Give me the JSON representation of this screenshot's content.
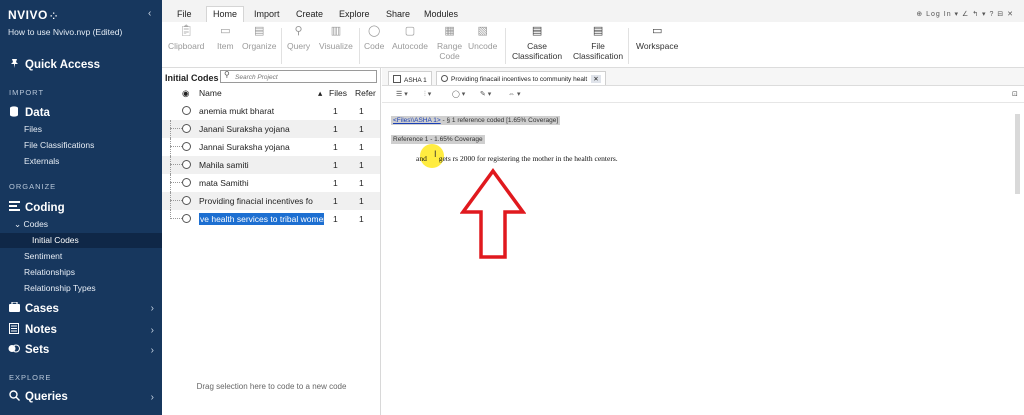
{
  "app": {
    "logo": "NVIVO",
    "logo_dots": "⁘",
    "project_name": "How to use Nvivo.nvp (Edited)"
  },
  "sidebar": {
    "collapse": "‹",
    "quick_access": "Quick Access",
    "section_import": "IMPORT",
    "data": "Data",
    "data_items": [
      "Files",
      "File Classifications",
      "Externals"
    ],
    "section_organize": "ORGANIZE",
    "coding": "Coding",
    "coding_codes": "Codes",
    "coding_initial_codes": "Initial Codes",
    "coding_items": [
      "Sentiment",
      "Relationships",
      "Relationship Types"
    ],
    "cases": "Cases",
    "notes": "Notes",
    "sets": "Sets",
    "section_explore": "EXPLORE",
    "queries": "Queries"
  },
  "ribbon": {
    "tabs": [
      "File",
      "Home",
      "Import",
      "Create",
      "Explore",
      "Share",
      "Modules"
    ],
    "active_tab": "Home",
    "top_right": "⊕ Log In ▾ ∠ ↰ ▾ ? ⊟ ✕",
    "buttons": {
      "clipboard": "Clipboard",
      "item": "Item",
      "organize": "Organize",
      "query": "Query",
      "visualize": "Visualize",
      "code": "Code",
      "autocode": "Autocode",
      "range_code_1": "Range",
      "range_code_2": "Code",
      "uncode": "Uncode",
      "case_class_1": "Case",
      "case_class_2": "Classification",
      "file_class_1": "File",
      "file_class_2": "Classification",
      "workspace": "Workspace"
    }
  },
  "codes_panel": {
    "title": "Initial Codes",
    "search_placeholder": "Search Project",
    "columns": {
      "name": "Name",
      "files": "Files",
      "refs": "Refer"
    },
    "rows": [
      {
        "name": "anemia mukt bharat",
        "files": "1",
        "refs": "1"
      },
      {
        "name": "Janani Suraksha yojana",
        "files": "1",
        "refs": "1"
      },
      {
        "name": "Jannai Suraksha yojana",
        "files": "1",
        "refs": "1"
      },
      {
        "name": "Mahila samiti",
        "files": "1",
        "refs": "1"
      },
      {
        "name": "mata Samithi",
        "files": "1",
        "refs": "1"
      },
      {
        "name": "Providing  finacial incentives fo",
        "files": "1",
        "refs": "1"
      },
      {
        "name": "ve health services to tribal women",
        "files": "1",
        "refs": "1"
      }
    ],
    "drag_hint": "Drag selection here to code to a new code"
  },
  "document": {
    "tabs": [
      {
        "label": "ASHA 1"
      },
      {
        "label": "Providing finacail incentives to community healt"
      }
    ],
    "close_label": "✕",
    "reference_link": "<Files\\\\ASHA 1>",
    "reference_summary": " - § 1 reference coded  [1.65% Coverage]",
    "reference_coverage": "Reference 1 - 1.65% Coverage",
    "text_before": "and ",
    "text_after": "gets rs 2000 for registering the mother in the health centers.",
    "annotation_arrow_color": "#e0191e",
    "highlight_color": "#ffe600"
  }
}
